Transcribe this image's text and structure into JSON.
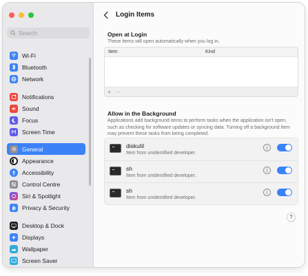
{
  "window": {
    "search": {
      "placeholder": "Search"
    }
  },
  "sidebar": {
    "groups": [
      [
        {
          "label": "Wi-Fi",
          "icon": "wifi-icon",
          "color": "#3b82f7"
        },
        {
          "label": "Bluetooth",
          "icon": "bluetooth-icon",
          "color": "#3b82f7"
        },
        {
          "label": "Network",
          "icon": "network-icon",
          "color": "#3b82f7"
        }
      ],
      [
        {
          "label": "Notifications",
          "icon": "notifications-icon",
          "color": "#f0473c"
        },
        {
          "label": "Sound",
          "icon": "sound-icon",
          "color": "#f0473c"
        },
        {
          "label": "Focus",
          "icon": "focus-icon",
          "color": "#5e5ce6"
        },
        {
          "label": "Screen Time",
          "icon": "screen-time-icon",
          "color": "#5e5ce6"
        }
      ],
      [
        {
          "label": "General",
          "icon": "gear-icon",
          "color": "#8e8e93",
          "selected": true
        },
        {
          "label": "Appearance",
          "icon": "appearance-icon",
          "color": "#1d1d1f"
        },
        {
          "label": "Accessibility",
          "icon": "accessibility-icon",
          "color": "#3b82f7"
        },
        {
          "label": "Control Centre",
          "icon": "control-centre-icon",
          "color": "#8e8e93"
        },
        {
          "label": "Siri & Spotlight",
          "icon": "siri-icon",
          "color": "#c044d8"
        },
        {
          "label": "Privacy & Security",
          "icon": "privacy-hand-icon",
          "color": "#3b82f7"
        }
      ],
      [
        {
          "label": "Desktop & Dock",
          "icon": "desktop-dock-icon",
          "color": "#1d1d1f"
        },
        {
          "label": "Displays",
          "icon": "displays-icon",
          "color": "#3b82f7"
        },
        {
          "label": "Wallpaper",
          "icon": "wallpaper-icon",
          "color": "#34aadc"
        },
        {
          "label": "Screen Saver",
          "icon": "screen-saver-icon",
          "color": "#34aadc"
        }
      ]
    ]
  },
  "main": {
    "title": "Login Items",
    "open_at_login": {
      "title": "Open at Login",
      "subtitle": "These items will open automatically when you log in.",
      "columns": [
        "Item",
        "Kind"
      ],
      "add_label": "+",
      "remove_label": "−"
    },
    "background": {
      "title": "Allow in the Background",
      "subtitle": "Applications add background items to perform tasks when the application isn't open, such as checking for software updates or syncing data. Turning off a background item may prevent these tasks from being completed.",
      "items": [
        {
          "name": "diskutil",
          "desc": "Item from unidentified developer.",
          "enabled": true
        },
        {
          "name": "sh",
          "desc": "Item from unidentified developer.",
          "enabled": true
        },
        {
          "name": "sh",
          "desc": "Item from unidentified developer.",
          "enabled": true
        }
      ]
    },
    "info_label": "i",
    "help_label": "?"
  }
}
